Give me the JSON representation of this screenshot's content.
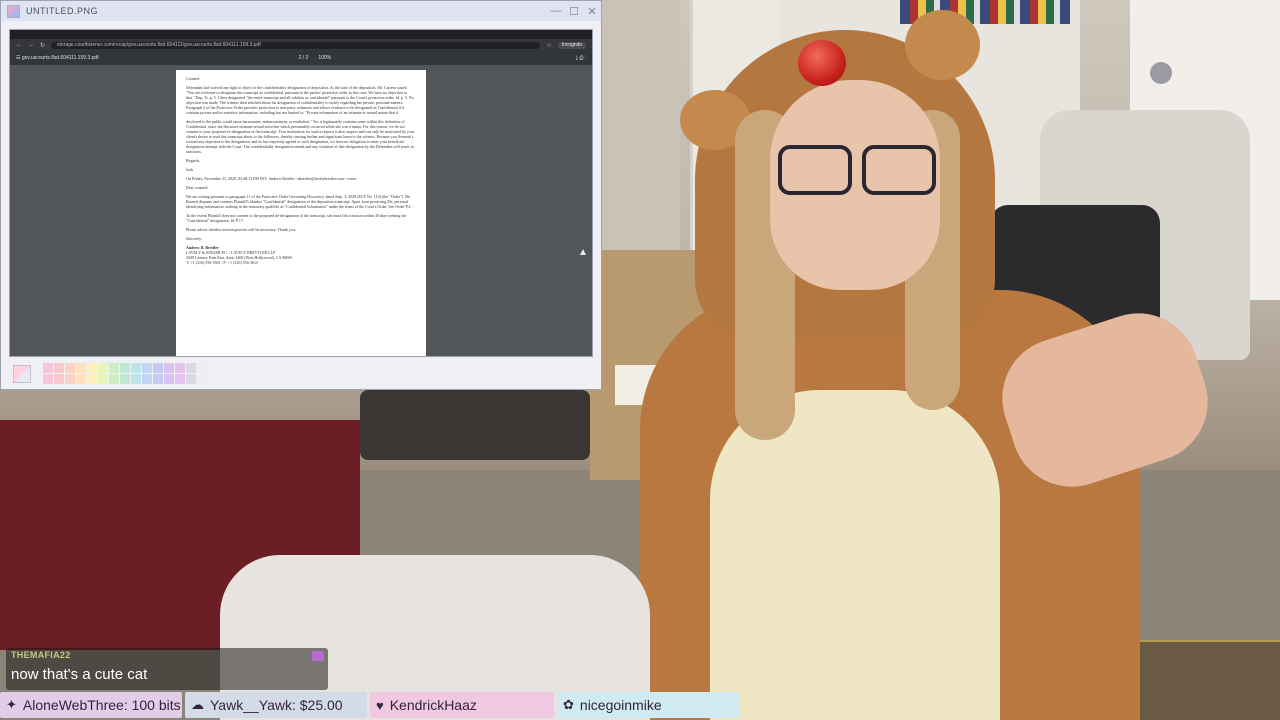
{
  "window": {
    "title": "UNTITLED.PNG",
    "controls": {
      "minimize": "—",
      "maximize": "☐",
      "close": "✕"
    }
  },
  "browser": {
    "url": "storage.courtlistener.com/recap/gov.uscourts.flsd.604111/gov.uscourts.flsd.604111.159.3.pdf",
    "incognito_label": "Incognito",
    "pdf_filename": "gov.uscourts.flsd.604111.159.3.pdf",
    "pdf_page": "2 / 2",
    "pdf_zoom": "100%"
  },
  "document": {
    "salutation": "Counsel:",
    "para1": "Defendant had waived any right to object to the confidentiality designation of deposition. At the start of the deposition, Mr. Carrera stated: \"You are welcome to designate this transcript as confidential, pursuant to the parties' protective order in this case. We have no objection to that.\" Dep. Tr. p. 5. I then designated \"the entire transcript and all exhibits as confidential\" pursuant to the Court's protective order. Id. p. 5. No objection was made. The witness then testified about his designation of confidentiality to testify regarding her private, personal matters. Paragraph 2 of the Protective Order provides protection to non-party witnesses and allows evidence to be designated as Confidential if it contains private and/or sensitive information, including but not limited to: \"Private information of an intimate or sexual nature that if",
    "para2": "disclosed to the public could cause harassment, embarrassment, or retaliation.\" Yes it legitimately contains some within this definition of Confidential, since she discusses intimate sexual activities which presumably occurred while she was a minor. For this reason, we do not consent to your proposed re-designation of the transcript. Your motivation for such a request is also suspect and can only be motivated by your client's desire to read this transcript about to the followers, thereby causing further and significant harm to the witness. Because you Avenatti's waived any objection to the designation, and in fact expressly agreed to such designation, we have no obligation to enter your beneficial designation attempt with the Court. The confidentiality designation stands and any violation of that designation by the Defendant will result in sanctions.",
    "signoff": "Regards,",
    "signer": "Josh",
    "forward_header": "On Friday, November 21, 2020, 03:48:13 PM PST, Andrew Brettler <abrettler@lavelybrettler.com> wrote:",
    "greeting": "Dear counsel:",
    "para3": "We are writing pursuant to paragraph 11 of the Protective Order Governing Discovery, dated Sept. 3, 2020 (ECF No. 110) (the \"Order\"). Mr. Burnett disputes and contests Plaintiff's blanket \"Confidential\" designation of the deposition transcript. Apart from protecting Ms. personal identifying information, nothing in the testimony qualifies as \"Confidential Information\" under the terms of the Court's Order. See Order ¶ 2.",
    "para4": "To the extent Plaintiff does not consent to the proposed de-designation of the transcript, she must file a motion within 30 days seeking the \"Confidential\" designation. Id. ¶ 17.",
    "para5": "Please advise whether motion practice will be necessary. Thank you.",
    "closing": "Sincerely,",
    "sig_name": "Andrew B. Brettler",
    "sig_line1": "LAVELY & SINGER P.C. / LAVELY BRETTLER LLP",
    "sig_line2": "2049 Century Park East, Suite 2400 (West Hollywood), CA 90069",
    "sig_line3": "T: +1 (310) 556-3501 | F: +1 (310) 556-3615"
  },
  "chat": {
    "username": "THEMAFIA22",
    "message": "now that's a cute cat"
  },
  "ticker": [
    {
      "icon": "✦",
      "text": "AloneWebThree: 100 bits"
    },
    {
      "icon": "☁",
      "text": "Yawk__Yawk: $25.00"
    },
    {
      "icon": "♥",
      "text": "KendrickHaaz"
    },
    {
      "icon": "✿",
      "text": "nicegoinmike"
    }
  ],
  "colors": {
    "chat_username": "#c5c887",
    "ticker_bits": "#e2cde8",
    "ticker_tip": "#d3dbe6",
    "ticker_follow": "#f0c8e2",
    "ticker_sub": "#cfeaf0"
  }
}
